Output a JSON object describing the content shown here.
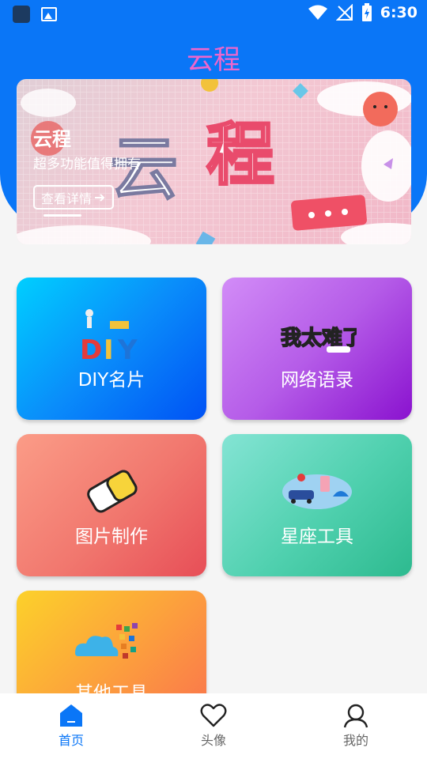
{
  "status_bar": {
    "time": "6:30"
  },
  "header": {
    "title": "云程"
  },
  "banner": {
    "title": "云程",
    "subtitle": "超多功能值得拥有",
    "button_label": "查看详情",
    "art_text": "云 程"
  },
  "cards": [
    {
      "label": "DIY名片",
      "icon": "diy-icon"
    },
    {
      "label": "网络语录",
      "icon": "quote-icon"
    },
    {
      "label": "图片制作",
      "icon": "eraser-icon"
    },
    {
      "label": "星座工具",
      "icon": "travel-icon"
    },
    {
      "label": "其他工具",
      "icon": "cloud-apps-icon"
    }
  ],
  "bottom_nav": [
    {
      "label": "首页",
      "icon": "home-icon",
      "active": true
    },
    {
      "label": "头像",
      "icon": "heart-icon",
      "active": false
    },
    {
      "label": "我的",
      "icon": "user-icon",
      "active": false
    }
  ],
  "colors": {
    "primary": "#0a76f7",
    "title_pink": "#ee66cc"
  }
}
